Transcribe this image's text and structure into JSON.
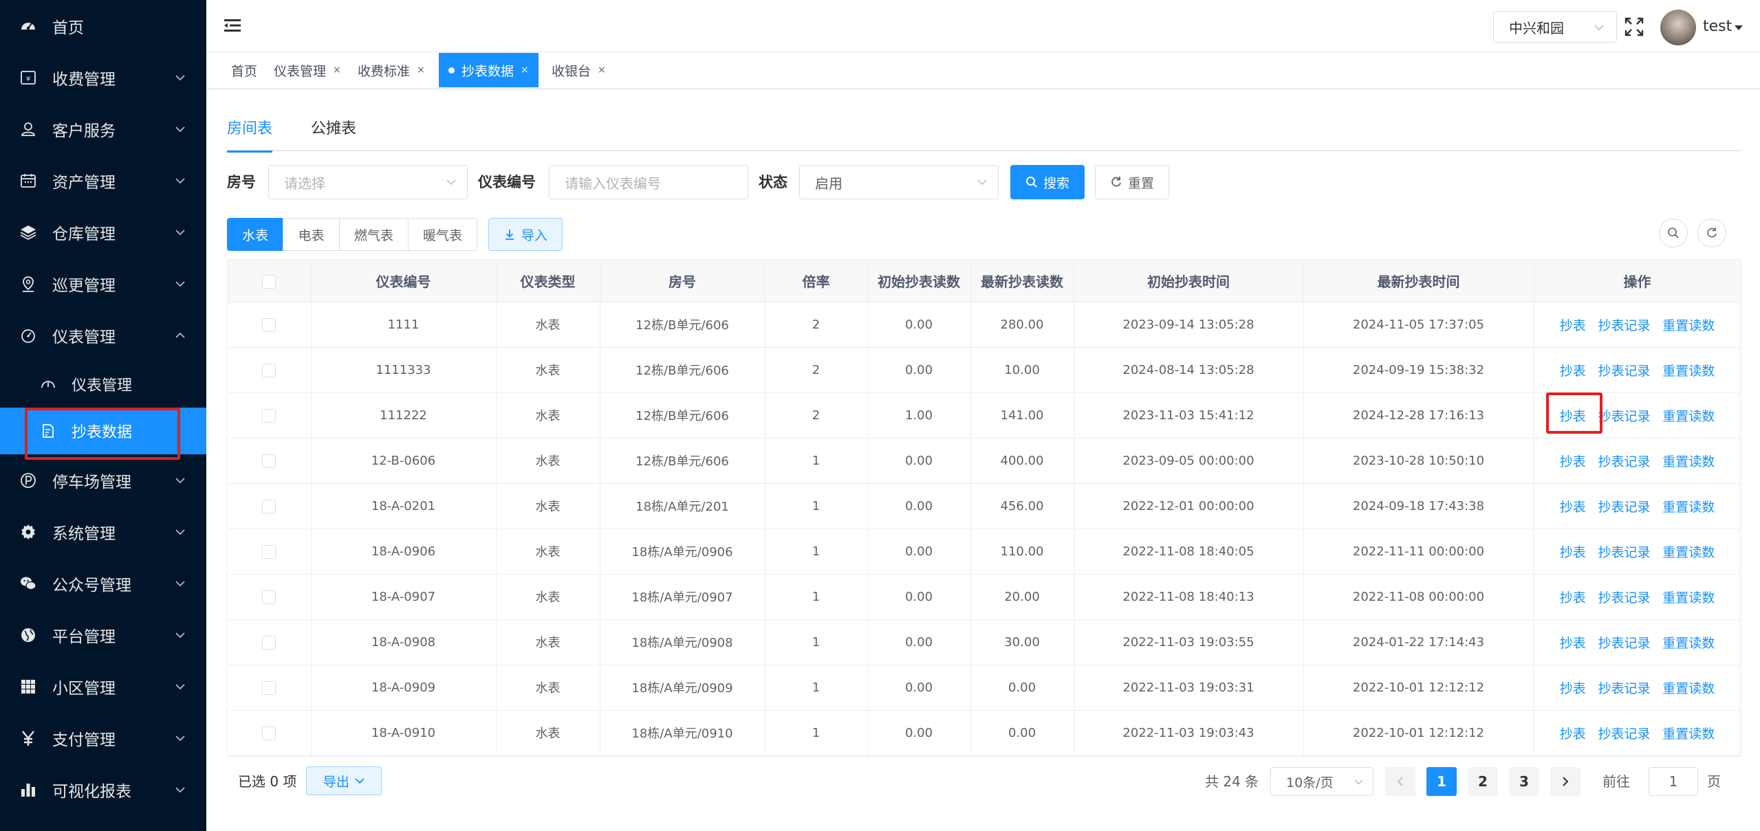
{
  "sidebar": {
    "items": [
      {
        "label": "首页",
        "icon": "dashboard-icon",
        "has_arrow": false
      },
      {
        "label": "收费管理",
        "icon": "wallet-icon",
        "has_arrow": true
      },
      {
        "label": "客户服务",
        "icon": "user-service-icon",
        "has_arrow": true
      },
      {
        "label": "资产管理",
        "icon": "calendar-icon",
        "has_arrow": true
      },
      {
        "label": "仓库管理",
        "icon": "layers-icon",
        "has_arrow": true
      },
      {
        "label": "巡更管理",
        "icon": "location-icon",
        "has_arrow": true
      },
      {
        "label": "仪表管理",
        "icon": "gauge-icon",
        "has_arrow": true,
        "expanded": true
      }
    ],
    "sub_items": [
      {
        "label": "仪表管理",
        "icon": "meter-icon"
      },
      {
        "label": "抄表数据",
        "icon": "edit-doc-icon",
        "active": true
      }
    ],
    "items_after": [
      {
        "label": "停车场管理",
        "icon": "parking-icon"
      },
      {
        "label": "系统管理",
        "icon": "gear-icon"
      },
      {
        "label": "公众号管理",
        "icon": "wechat-icon"
      },
      {
        "label": "平台管理",
        "icon": "globe-icon"
      },
      {
        "label": "小区管理",
        "icon": "grid-icon"
      },
      {
        "label": "支付管理",
        "icon": "yen-icon"
      },
      {
        "label": "可视化报表",
        "icon": "bar-chart-icon"
      }
    ]
  },
  "header": {
    "community": "中兴和园",
    "user": "test"
  },
  "tags": [
    {
      "label": "首页",
      "closable": false
    },
    {
      "label": "仪表管理",
      "closable": true
    },
    {
      "label": "收费标准",
      "closable": true
    },
    {
      "label": "抄表数据",
      "closable": true,
      "active": true
    },
    {
      "label": "收银台",
      "closable": true
    }
  ],
  "tag_close": "×",
  "sub_tabs": [
    "房间表",
    "公摊表"
  ],
  "filters": {
    "room_label": "房号",
    "room_placeholder": "请选择",
    "meter_label": "仪表编号",
    "meter_placeholder": "请输入仪表编号",
    "status_label": "状态",
    "status_value": "启用",
    "search_btn": "搜索",
    "reset_btn": "重置"
  },
  "meter_types": [
    "水表",
    "电表",
    "燃气表",
    "暖气表"
  ],
  "import_btn": "导入",
  "table": {
    "columns": [
      "仪表编号",
      "仪表类型",
      "房号",
      "倍率",
      "初始抄表读数",
      "最新抄表读数",
      "初始抄表时间",
      "最新抄表时间",
      "操作"
    ],
    "actions": [
      "抄表",
      "抄表记录",
      "重置读数"
    ],
    "rows": [
      [
        "1111",
        "水表",
        "12栋/B单元/606",
        "2",
        "0.00",
        "280.00",
        "2023-09-14 13:05:28",
        "2024-11-05 17:37:05"
      ],
      [
        "1111333",
        "水表",
        "12栋/B单元/606",
        "2",
        "0.00",
        "10.00",
        "2024-08-14 13:05:28",
        "2024-09-19 15:38:32"
      ],
      [
        "111222",
        "水表",
        "12栋/B单元/606",
        "2",
        "1.00",
        "141.00",
        "2023-11-03 15:41:12",
        "2024-12-28 17:16:13"
      ],
      [
        "12-B-0606",
        "水表",
        "12栋/B单元/606",
        "1",
        "0.00",
        "400.00",
        "2023-09-05 00:00:00",
        "2023-10-28 10:50:10"
      ],
      [
        "18-A-0201",
        "水表",
        "18栋/A单元/201",
        "1",
        "0.00",
        "456.00",
        "2022-12-01 00:00:00",
        "2024-09-18 17:43:38"
      ],
      [
        "18-A-0906",
        "水表",
        "18栋/A单元/0906",
        "1",
        "0.00",
        "110.00",
        "2022-11-08 18:40:05",
        "2022-11-11 00:00:00"
      ],
      [
        "18-A-0907",
        "水表",
        "18栋/A单元/0907",
        "1",
        "0.00",
        "20.00",
        "2022-11-08 18:40:13",
        "2022-11-08 00:00:00"
      ],
      [
        "18-A-0908",
        "水表",
        "18栋/A单元/0908",
        "1",
        "0.00",
        "30.00",
        "2022-11-03 19:03:55",
        "2024-01-22 17:14:43"
      ],
      [
        "18-A-0909",
        "水表",
        "18栋/A单元/0909",
        "1",
        "0.00",
        "0.00",
        "2022-11-03 19:03:31",
        "2022-10-01 12:12:12"
      ],
      [
        "18-A-0910",
        "水表",
        "18栋/A单元/0910",
        "1",
        "0.00",
        "0.00",
        "2022-11-03 19:03:43",
        "2022-10-01 12:12:12"
      ]
    ]
  },
  "footer": {
    "selected": "已选 0 项",
    "export_btn": "导出",
    "total": "共 24 条",
    "page_size": "10条/页",
    "pages": [
      "1",
      "2",
      "3"
    ],
    "current_page": "1",
    "goto_label": "前往",
    "goto_value": "1",
    "page_suffix": "页"
  },
  "colors": {
    "primary": "#1890ff",
    "sidebar_bg": "#001529",
    "highlight": "#e02020"
  }
}
